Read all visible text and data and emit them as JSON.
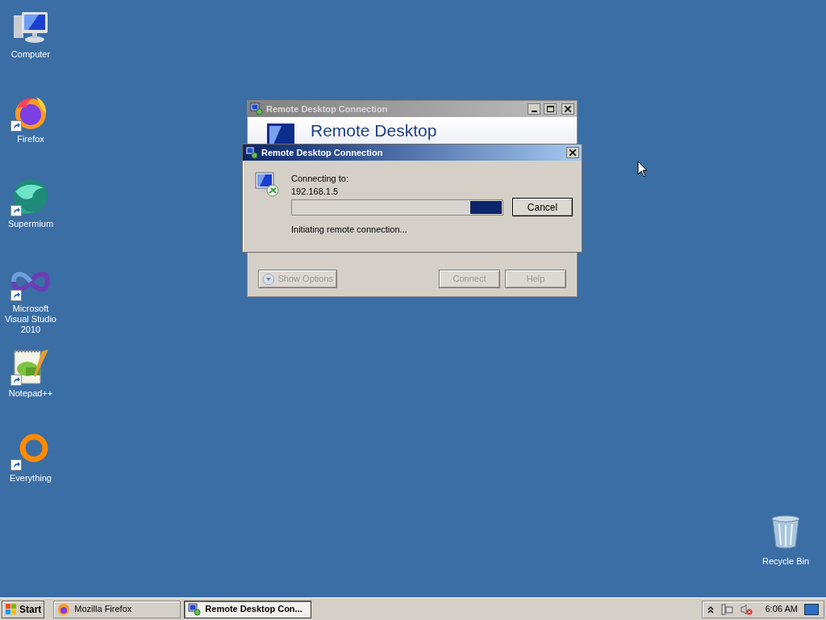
{
  "desktop_icons": [
    {
      "label": "Computer",
      "kind": "computer",
      "shortcut": false
    },
    {
      "label": "Firefox",
      "kind": "firefox",
      "shortcut": true
    },
    {
      "label": "Supermium",
      "kind": "supermium",
      "shortcut": true
    },
    {
      "label": "Microsoft Visual Studio 2010",
      "kind": "vs",
      "shortcut": true
    },
    {
      "label": "Notepad++",
      "kind": "notepad",
      "shortcut": true
    },
    {
      "label": "Everything",
      "kind": "everything",
      "shortcut": true
    }
  ],
  "recycle_bin": {
    "label": "Recycle Bin"
  },
  "main_window": {
    "title": "Remote Desktop Connection",
    "header": "Remote Desktop",
    "buttons": [
      {
        "label": "Show Options",
        "kind": "options",
        "disabled": true
      },
      {
        "label": "Connect",
        "kind": "plain",
        "disabled": true
      },
      {
        "label": "Help",
        "kind": "plain",
        "disabled": true
      }
    ]
  },
  "dialog": {
    "title": "Remote Desktop Connection",
    "connecting_label": "Connecting to:",
    "address": "192.168.1.5",
    "status": "Initiating remote connection...",
    "level": 0.15,
    "cancel": "Cancel"
  },
  "taskbar": {
    "start": "Start",
    "tasks": [
      {
        "label": "Mozilla Firefox",
        "kind": "firefox",
        "selected": false
      },
      {
        "label": "Remote Desktop Con...",
        "kind": "rdp",
        "selected": true
      }
    ],
    "clock": "6:06 AM"
  }
}
